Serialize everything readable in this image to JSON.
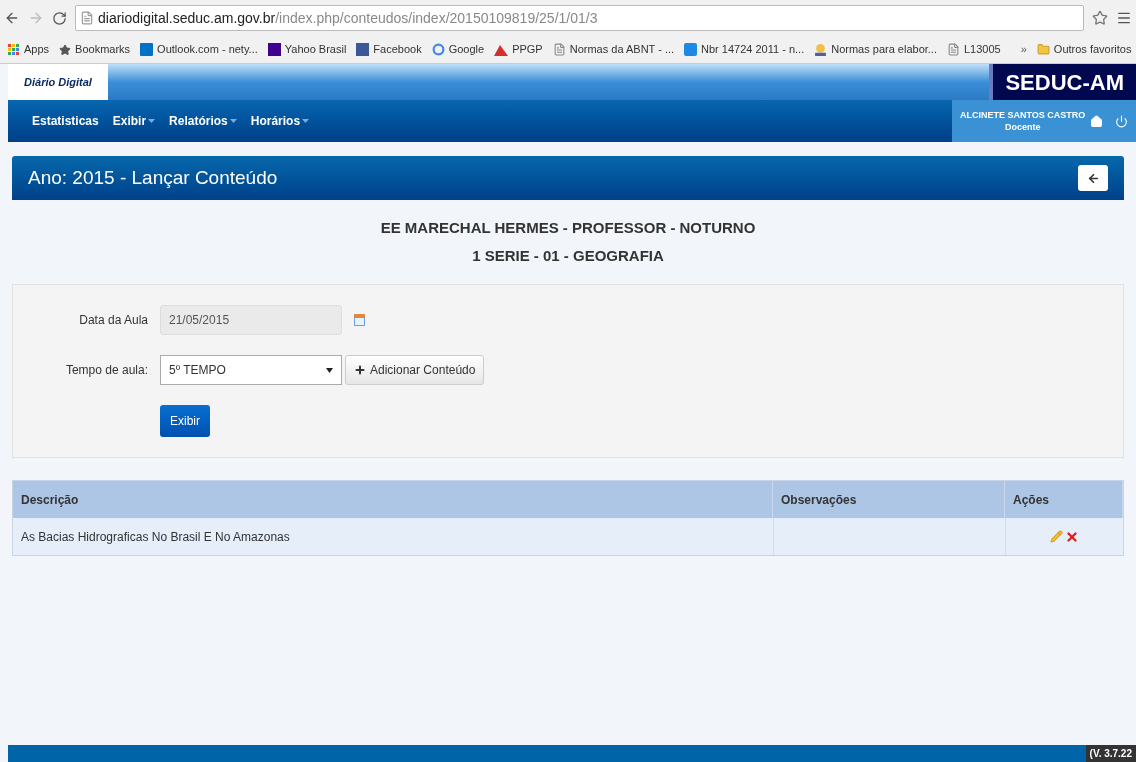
{
  "browser": {
    "url_host": "diariodigital.seduc.am.gov.br",
    "url_path": "/index.php/conteudos/index/20150109819/25/1/01/3",
    "bookmarks": [
      {
        "kind": "apps",
        "label": "Apps"
      },
      {
        "kind": "star",
        "label": "Bookmarks"
      },
      {
        "kind": "outlook",
        "label": "Outlook.com - nety..."
      },
      {
        "kind": "yahoo",
        "label": "Yahoo Brasil"
      },
      {
        "kind": "facebook",
        "label": "Facebook"
      },
      {
        "kind": "google",
        "label": "Google"
      },
      {
        "kind": "ppgp",
        "label": "PPGP"
      },
      {
        "kind": "page",
        "label": "Normas da ABNT - ..."
      },
      {
        "kind": "nbr",
        "label": "Nbr 14724 2011 - n..."
      },
      {
        "kind": "normas",
        "label": "Normas para elabor..."
      },
      {
        "kind": "page",
        "label": "L13005"
      }
    ],
    "overflow": "»",
    "other_bookmarks": "Outros favoritos"
  },
  "header": {
    "logo": "Diário Digital",
    "brand": "SEDUC-AM"
  },
  "nav": {
    "items": [
      {
        "label": "Estatisticas",
        "dropdown": false
      },
      {
        "label": "Exibir",
        "dropdown": true
      },
      {
        "label": "Relatórios",
        "dropdown": true
      },
      {
        "label": "Horários",
        "dropdown": true
      }
    ],
    "user_name": "ALCINETE SANTOS CASTRO",
    "user_role": "Docente"
  },
  "page": {
    "title": "Ano: 2015 - Lançar Conteúdo",
    "heading_lines": [
      "EE MARECHAL HERMES - PROFESSOR - NOTURNO",
      "1 SERIE - 01 - GEOGRAFIA"
    ]
  },
  "form": {
    "date_label": "Data da Aula",
    "date_value": "21/05/2015",
    "date_disabled": true,
    "time_label": "Tempo de aula:",
    "time_value": "5º TEMPO",
    "add_button": "Adicionar Conteúdo",
    "submit_button": "Exibir"
  },
  "table": {
    "columns": [
      "Descrição",
      "Observações",
      "Ações"
    ],
    "rows": [
      {
        "description": "As Bacias Hidrograficas No Brasil E No Amazonas"
      }
    ]
  },
  "footer": {
    "version": "(V. 3.7.22"
  }
}
